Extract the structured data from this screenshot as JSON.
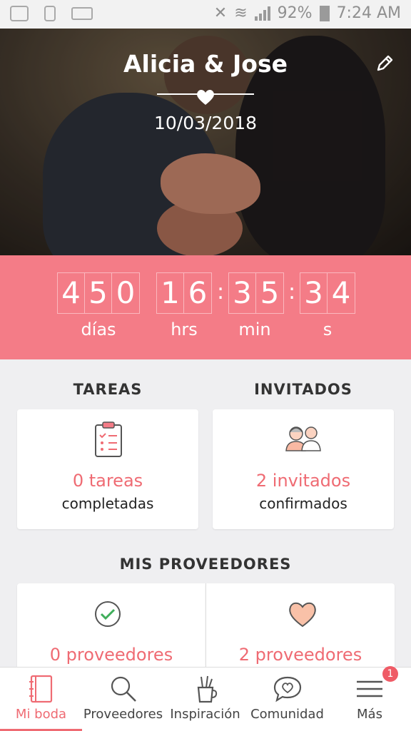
{
  "statusbar": {
    "battery": "92%",
    "time": "7:24 AM"
  },
  "hero": {
    "couple_names": "Alicia & Jose",
    "date": "10/03/2018"
  },
  "countdown": {
    "days": [
      "4",
      "5",
      "0"
    ],
    "hours": [
      "1",
      "6"
    ],
    "minutes": [
      "3",
      "5"
    ],
    "seconds": [
      "3",
      "4"
    ],
    "units": {
      "days": "días",
      "hours": "hrs",
      "minutes": "min",
      "seconds": "s"
    }
  },
  "tasks": {
    "title": "TAREAS",
    "count_text": "0 tareas",
    "sub_text": "completadas"
  },
  "guests": {
    "title": "INVITADOS",
    "count_text": "2 invitados",
    "sub_text": "confirmados"
  },
  "vendors": {
    "title": "MIS PROVEEDORES",
    "hired_text": "0 proveedores",
    "fav_text": "2 proveedores"
  },
  "nav": {
    "items": [
      {
        "label": "Mi boda",
        "icon": "notebook-icon"
      },
      {
        "label": "Proveedores",
        "icon": "search-icon"
      },
      {
        "label": "Inspiración",
        "icon": "brush-cup-icon"
      },
      {
        "label": "Comunidad",
        "icon": "chat-heart-icon"
      },
      {
        "label": "Más",
        "icon": "menu-icon"
      }
    ],
    "badge": "1"
  },
  "colors": {
    "accent": "#f47c87",
    "accent_text": "#ef6b73"
  }
}
